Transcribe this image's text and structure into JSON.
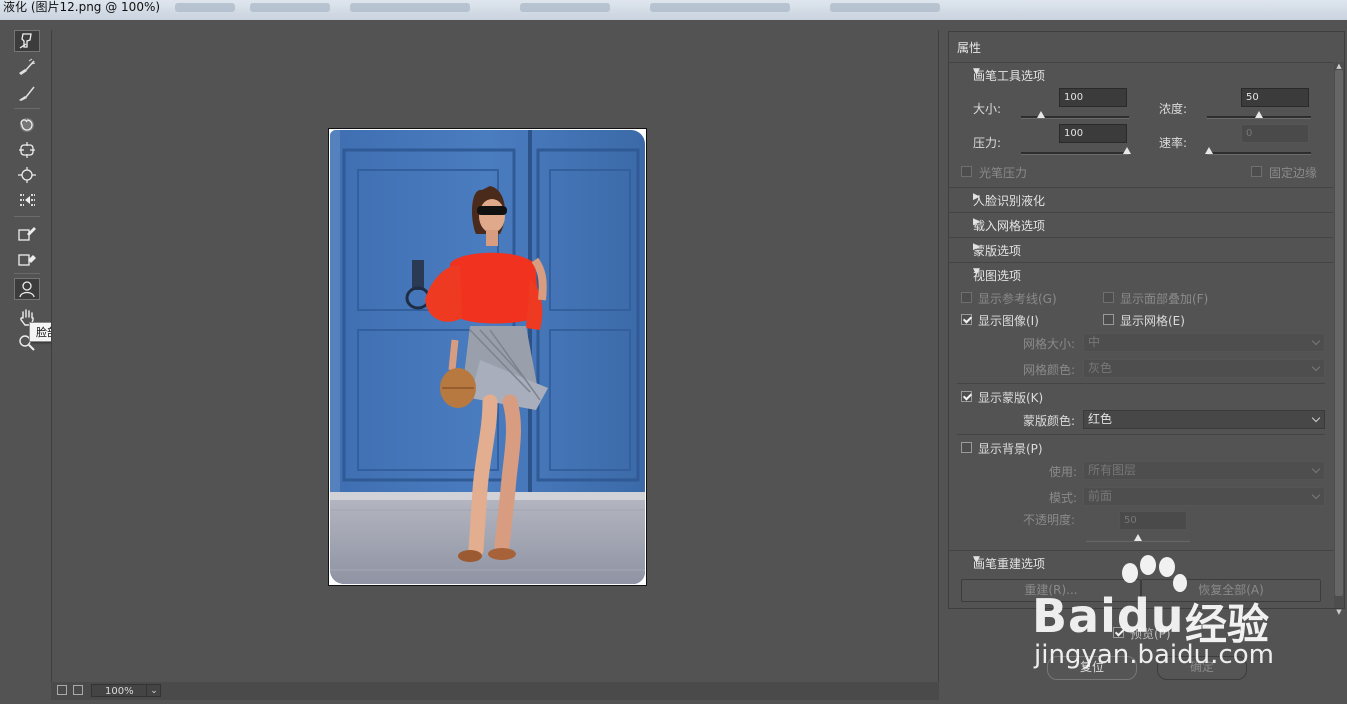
{
  "window": {
    "title": "液化 (图片12.png @ 100%)"
  },
  "tools": [
    {
      "name": "forward-warp-tool-icon"
    },
    {
      "name": "reconstruct-tool-icon"
    },
    {
      "name": "smooth-tool-icon"
    },
    {
      "name": "twirl-tool-icon"
    },
    {
      "name": "pucker-tool-icon"
    },
    {
      "name": "bloat-tool-icon"
    },
    {
      "name": "push-left-tool-icon"
    },
    {
      "name": "freeze-mask-tool-icon"
    },
    {
      "name": "thaw-mask-tool-icon"
    },
    {
      "name": "face-tool-icon"
    },
    {
      "name": "hand-tool-icon"
    },
    {
      "name": "zoom-tool-icon"
    }
  ],
  "tooltip": "脸部工具 (A)",
  "status": {
    "zoom": "100%"
  },
  "panel": {
    "title": "属性",
    "brush_options": {
      "header": "画笔工具选项",
      "size_label": "大小:",
      "size_value": "100",
      "size_level": 0.1,
      "density_label": "浓度:",
      "density_value": "50",
      "density_level": 0.5,
      "pressure_label": "压力:",
      "pressure_value": "100",
      "pressure_level": 1.0,
      "rate_label": "速率:",
      "rate_value": "0",
      "rate_level": 0.0,
      "stylus_label": "光笔压力",
      "pin_edges_label": "固定边缘"
    },
    "face_aware": {
      "header": "人脸识别液化"
    },
    "load_mesh": {
      "header": "载入网格选项"
    },
    "mask_options": {
      "header": "蒙版选项"
    },
    "view_options": {
      "header": "视图选项",
      "show_guides": "显示参考线(G)",
      "show_face_overlay": "显示面部叠加(F)",
      "show_image": "显示图像(I)",
      "show_mesh": "显示网格(E)",
      "mesh_size_label": "网格大小:",
      "mesh_size_value": "中",
      "mesh_color_label": "网格颜色:",
      "mesh_color_value": "灰色",
      "show_mask": "显示蒙版(K)",
      "mask_color_label": "蒙版颜色:",
      "mask_color_value": "红色",
      "show_backdrop": "显示背景(P)",
      "use_label": "使用:",
      "use_value": "所有图层",
      "mode_label": "模式:",
      "mode_value": "前面",
      "opacity_label": "不透明度:",
      "opacity_value": "50",
      "opacity_level": 0.5
    },
    "reconstruct": {
      "header": "画笔重建选项",
      "reconstruct_button": "重建(R)...",
      "restore_all_button": "恢复全部(A)"
    }
  },
  "footer": {
    "preview_label": "预览(P)",
    "reset_button": "复位",
    "ok_button": "确定"
  },
  "watermark": {
    "brand": "Bai",
    "brand_suffix": "du",
    "cn": "经验",
    "url": "jingyan.baidu.com"
  }
}
